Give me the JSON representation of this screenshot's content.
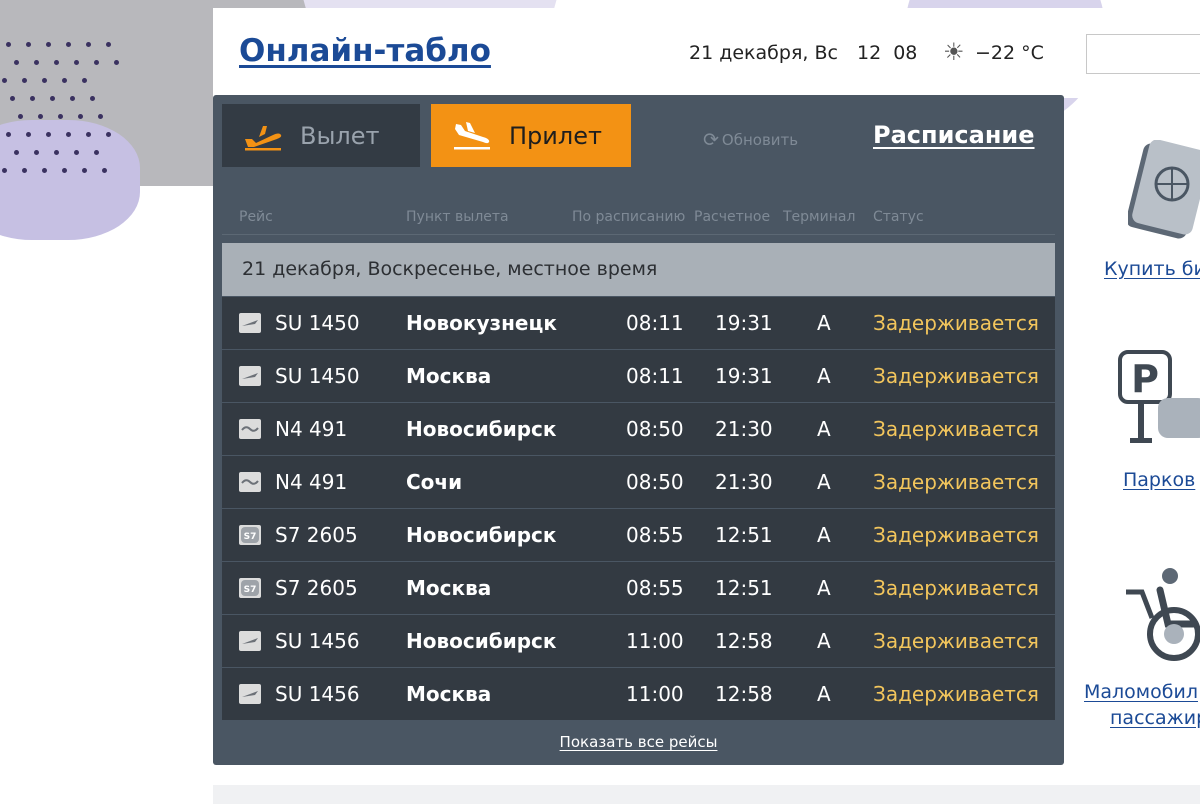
{
  "header": {
    "title": "Онлайн-табло",
    "date": "21 декабря, Вс",
    "time": "12 08",
    "weather_icon": "sun-icon",
    "temperature": "−22 °C"
  },
  "tabs": {
    "departure": {
      "label": "Вылет",
      "icon": "plane-takeoff-icon",
      "active": false
    },
    "arrival": {
      "label": "Прилет",
      "icon": "plane-landing-icon",
      "active": true
    }
  },
  "refresh_label": "Обновить",
  "schedule_link": "Расписание",
  "columns": [
    "Рейс",
    "Пункт вылета",
    "По расписанию",
    "Расчетное",
    "Терминал",
    "Статус"
  ],
  "date_header": "21 декабря, Воскресенье, местное время",
  "flights": [
    {
      "airline_logo": "aeroflot-logo",
      "flight": "SU 1450",
      "city": "Новокузнецк",
      "scheduled": "08:11",
      "estimated": "19:31",
      "terminal": "A",
      "status": "Задерживается"
    },
    {
      "airline_logo": "aeroflot-logo",
      "flight": "SU 1450",
      "city": "Москва",
      "scheduled": "08:11",
      "estimated": "19:31",
      "terminal": "A",
      "status": "Задерживается"
    },
    {
      "airline_logo": "nordwind-logo",
      "flight": "N4 491",
      "city": "Новосибирск",
      "scheduled": "08:50",
      "estimated": "21:30",
      "terminal": "A",
      "status": "Задерживается"
    },
    {
      "airline_logo": "nordwind-logo",
      "flight": "N4 491",
      "city": "Сочи",
      "scheduled": "08:50",
      "estimated": "21:30",
      "terminal": "A",
      "status": "Задерживается"
    },
    {
      "airline_logo": "s7-logo",
      "flight": "S7 2605",
      "city": "Новосибирск",
      "scheduled": "08:55",
      "estimated": "12:51",
      "terminal": "A",
      "status": "Задерживается"
    },
    {
      "airline_logo": "s7-logo",
      "flight": "S7 2605",
      "city": "Москва",
      "scheduled": "08:55",
      "estimated": "12:51",
      "terminal": "A",
      "status": "Задерживается"
    },
    {
      "airline_logo": "aeroflot-logo",
      "flight": "SU 1456",
      "city": "Новосибирск",
      "scheduled": "11:00",
      "estimated": "12:58",
      "terminal": "A",
      "status": "Задерживается"
    },
    {
      "airline_logo": "aeroflot-logo",
      "flight": "SU 1456",
      "city": "Москва",
      "scheduled": "11:00",
      "estimated": "12:58",
      "terminal": "A",
      "status": "Задерживается"
    }
  ],
  "show_all": "Показать все рейсы",
  "sidebar": {
    "items": [
      {
        "label": "Купить би",
        "icon": "passport-icon"
      },
      {
        "label": "Парков",
        "icon": "parking-icon"
      },
      {
        "label": "Маломобил",
        "label2": "пассажир",
        "icon": "wheelchair-icon"
      }
    ]
  },
  "colors": {
    "board_bg": "#4a5663",
    "row_bg": "#333a42",
    "accent_orange": "#f39214",
    "status_delayed": "#f2c55c",
    "link_blue": "#1b4a96"
  }
}
